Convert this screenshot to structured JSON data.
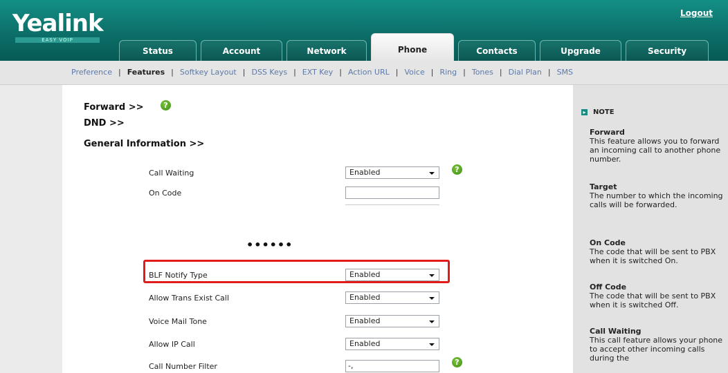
{
  "header": {
    "logo": "Yealink",
    "logo_sub": "EASY VOIP",
    "logout": "Logout",
    "tabs": [
      {
        "label": "Status"
      },
      {
        "label": "Account"
      },
      {
        "label": "Network"
      },
      {
        "label": "Phone"
      },
      {
        "label": "Contacts"
      },
      {
        "label": "Upgrade"
      },
      {
        "label": "Security"
      }
    ],
    "active_tab": "Phone",
    "accent_color": "#0c6f68"
  },
  "subnav": {
    "items": [
      {
        "label": "Preference"
      },
      {
        "label": "Features"
      },
      {
        "label": "Softkey Layout"
      },
      {
        "label": "DSS Keys"
      },
      {
        "label": "EXT Key"
      },
      {
        "label": "Action URL"
      },
      {
        "label": "Voice"
      },
      {
        "label": "Ring"
      },
      {
        "label": "Tones"
      },
      {
        "label": "Dial Plan"
      },
      {
        "label": "SMS"
      }
    ],
    "active": "Features"
  },
  "main": {
    "sections": {
      "forward": "Forward >>",
      "dnd": "DND >>",
      "general": "General Information >>"
    },
    "ellipsis": "••••••",
    "rows": [
      {
        "label": "Call Waiting",
        "value": "Enabled"
      },
      {
        "label": "On Code",
        "value": ""
      },
      {
        "label": "BLF Notify Type",
        "value": "Enabled"
      },
      {
        "label": "Allow Trans Exist Call",
        "value": "Enabled"
      },
      {
        "label": "Voice Mail Tone",
        "value": "Enabled"
      },
      {
        "label": "Allow IP Call",
        "value": "Enabled"
      },
      {
        "label": "Call Number Filter",
        "value": "-,"
      }
    ],
    "highlight_color": "#e11a1a"
  },
  "note": {
    "heading": "NOTE",
    "items": [
      {
        "title": "Forward",
        "desc": "This feature allows you to forward an incoming call to another phone number."
      },
      {
        "title": "Target",
        "desc": "The number to which the incoming calls will be forwarded."
      },
      {
        "title": "On Code",
        "desc": "The code that will be sent to PBX when it is switched On."
      },
      {
        "title": "Off Code",
        "desc": "The code that will be sent to PBX when it is switched Off."
      },
      {
        "title": "Call Waiting",
        "desc": "This call feature allows your phone to accept other incoming calls during the"
      }
    ]
  }
}
